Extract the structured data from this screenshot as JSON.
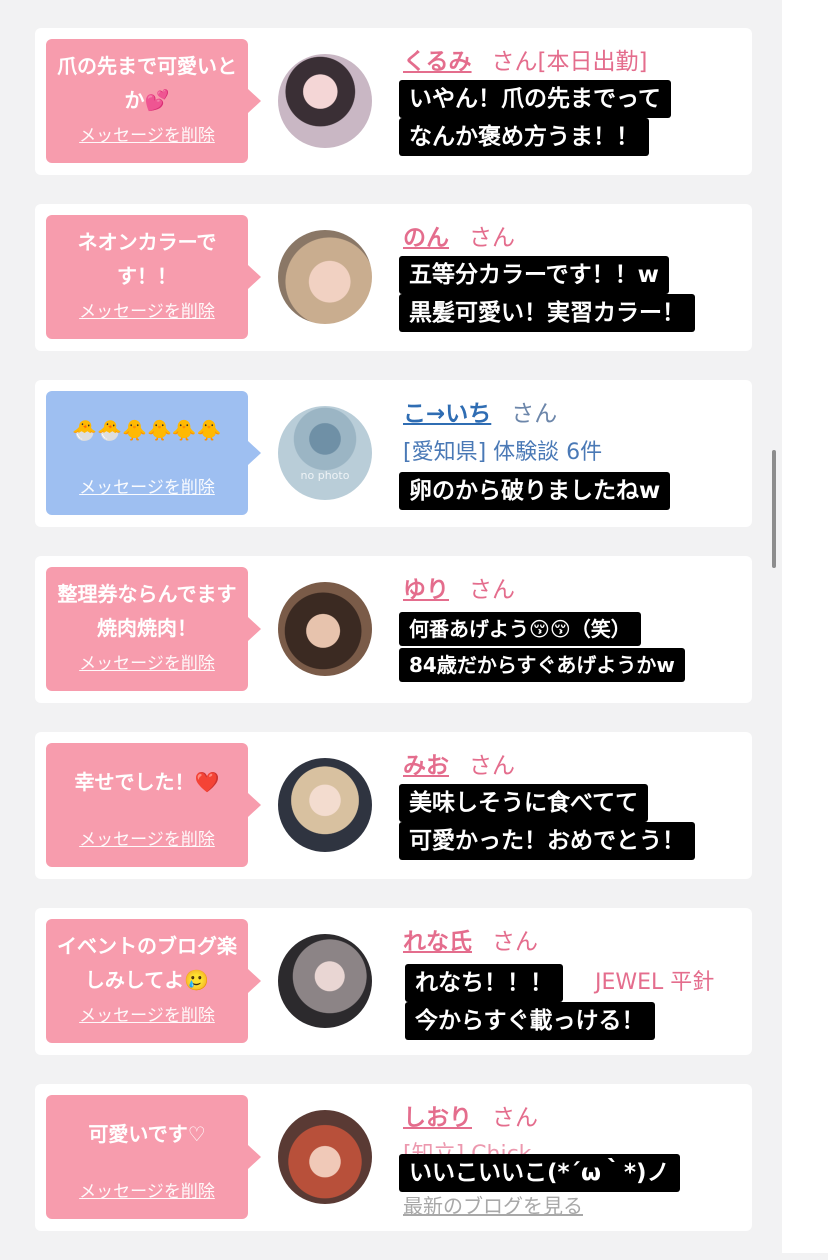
{
  "delete_label": "メッセージを削除",
  "honorific": "さん",
  "cards": [
    {
      "message": "爪の先まで可愛いとか💕",
      "name": "くるみ",
      "tag": "[本日出勤]",
      "caption": [
        "いやん！爪の先までって",
        "なんか褒め方うま！！"
      ]
    },
    {
      "message": "ネオンカラーです！！",
      "name": "のん",
      "caption": [
        "五等分カラーです！！w",
        "黒髪可愛い！実習カラー！"
      ]
    },
    {
      "message": "🐣🐣🐥🐥🐥🐥",
      "name": "こ→いち",
      "sub": "[愛知県] 体験談 6件",
      "avatar_text": "no photo",
      "caption": [
        "卵のから破りましたねw"
      ]
    },
    {
      "message": "整理券ならんでます焼肉焼肉！",
      "name": "ゆり",
      "caption": [
        "何番あげよう😚😚（笑）",
        "84歳だからすぐあげようかw"
      ]
    },
    {
      "message": "幸せでした！❤️",
      "name": "みお",
      "caption": [
        "美味しそうに食べてて",
        "可愛かった！おめでとう！"
      ]
    },
    {
      "message": "イベントのブログ楽しみしてよ🥲",
      "name": "れな氏",
      "sub": "JEWEL 平針",
      "caption": [
        "れなち！！！",
        "今からすぐ載っける！"
      ]
    },
    {
      "message": "可愛いです♡",
      "name": "しおり",
      "sub": "[知立] Chick",
      "sub2": "最新のブログを見る",
      "caption": [
        "いいこいいこ(*´ω｀*)ノ"
      ]
    }
  ]
}
